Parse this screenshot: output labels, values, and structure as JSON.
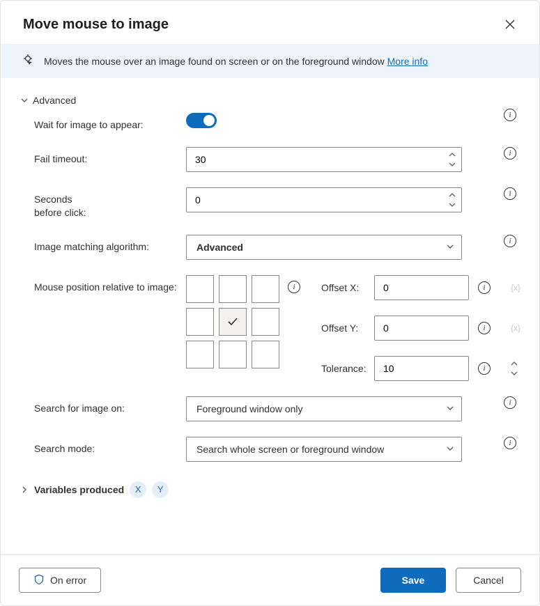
{
  "header": {
    "title": "Move mouse to image"
  },
  "infobar": {
    "text": "Moves the mouse over an image found on screen or on the foreground window ",
    "link": "More info"
  },
  "sections": {
    "advanced": {
      "label": "Advanced",
      "fields": {
        "wait_for_image": {
          "label": "Wait for image to appear:",
          "value": true
        },
        "fail_timeout": {
          "label": "Fail timeout:",
          "value": "30"
        },
        "seconds_before_click": {
          "label": "Seconds\nbefore click:",
          "value": "0"
        },
        "matching_algorithm": {
          "label": "Image matching algorithm:",
          "value": "Advanced"
        },
        "mouse_position": {
          "label": "Mouse position relative to image:",
          "selected_cell": 4,
          "offset_x": {
            "label": "Offset X:",
            "value": "0"
          },
          "offset_y": {
            "label": "Offset Y:",
            "value": "0"
          },
          "tolerance": {
            "label": "Tolerance:",
            "value": "10"
          }
        },
        "search_on": {
          "label": "Search for image on:",
          "value": "Foreground window only"
        },
        "search_mode": {
          "label": "Search mode:",
          "value": "Search whole screen or foreground window"
        }
      }
    },
    "variables": {
      "label": "Variables produced",
      "vars": [
        "X",
        "Y"
      ]
    }
  },
  "footer": {
    "on_error": "On error",
    "save": "Save",
    "cancel": "Cancel"
  }
}
